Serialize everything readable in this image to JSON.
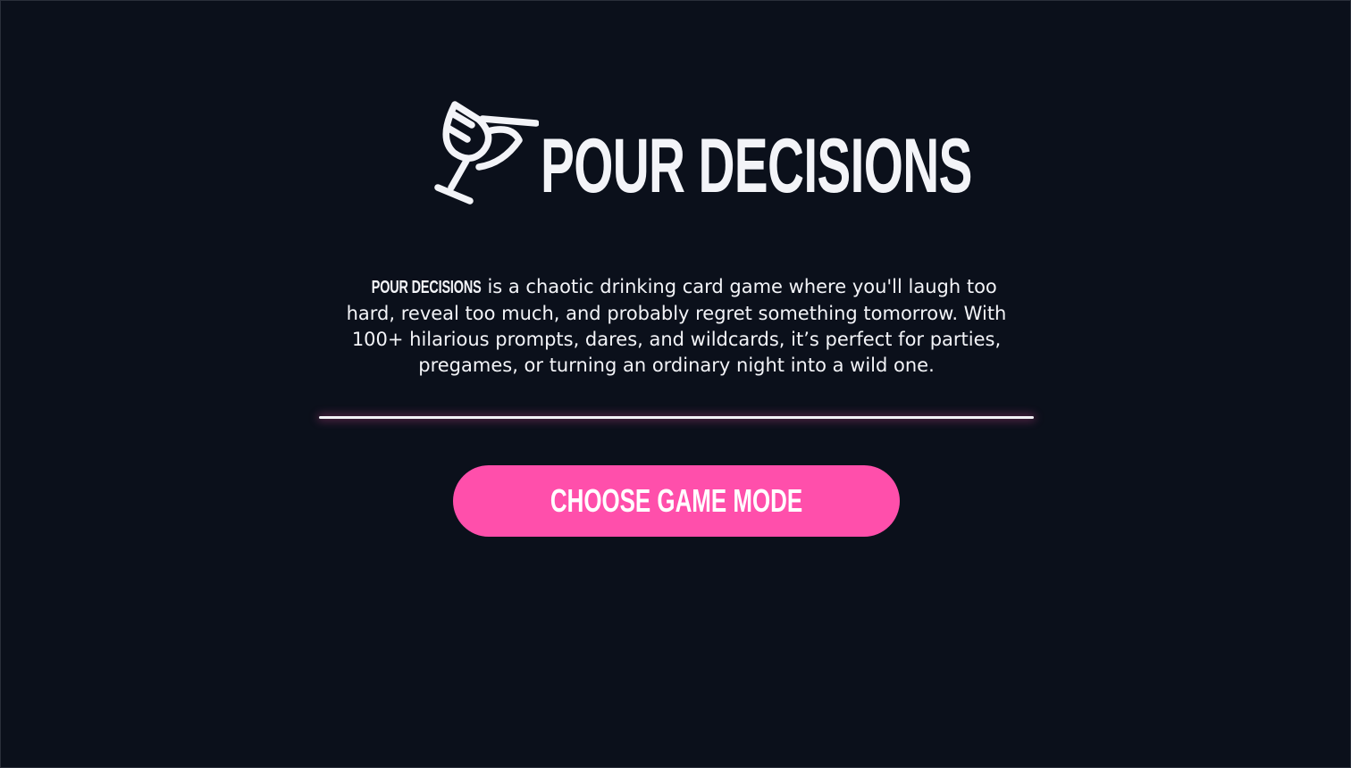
{
  "app": {
    "title": "POUR DECISIONS",
    "logo_icon": "cocktail-glass-icon"
  },
  "intro": {
    "brand": "POUR DECISIONS",
    "text": " is a chaotic drinking card game where you'll laugh too hard, reveal too much, and probably regret something tomorrow. With 100+ hilarious prompts, dares, and wildcards, it’s perfect for parties, pregames, or turning an ordinary night into a wild one."
  },
  "actions": {
    "choose_mode_label": "CHOOSE GAME MODE"
  },
  "colors": {
    "background": "#0b101b",
    "text": "#f3f4f8",
    "accent": "#ff4fab"
  }
}
